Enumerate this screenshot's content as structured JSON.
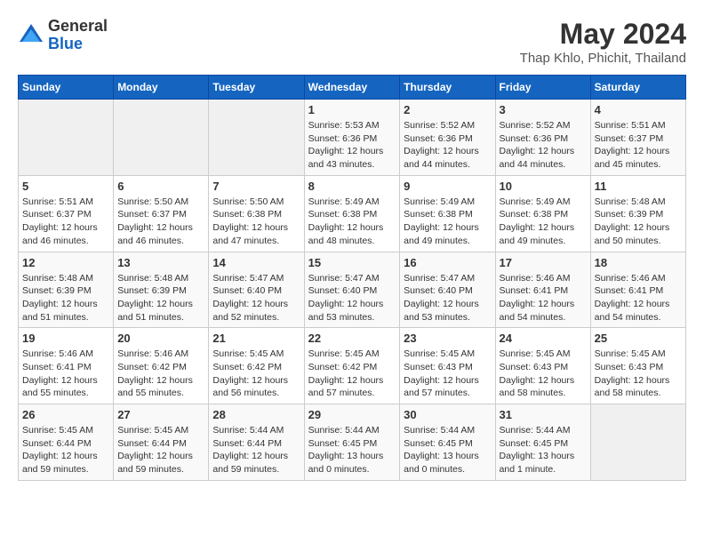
{
  "header": {
    "logo_line1": "General",
    "logo_line2": "Blue",
    "month": "May 2024",
    "location": "Thap Khlo, Phichit, Thailand"
  },
  "weekdays": [
    "Sunday",
    "Monday",
    "Tuesday",
    "Wednesday",
    "Thursday",
    "Friday",
    "Saturday"
  ],
  "weeks": [
    [
      {
        "day": "",
        "info": ""
      },
      {
        "day": "",
        "info": ""
      },
      {
        "day": "",
        "info": ""
      },
      {
        "day": "1",
        "info": "Sunrise: 5:53 AM\nSunset: 6:36 PM\nDaylight: 12 hours\nand 43 minutes."
      },
      {
        "day": "2",
        "info": "Sunrise: 5:52 AM\nSunset: 6:36 PM\nDaylight: 12 hours\nand 44 minutes."
      },
      {
        "day": "3",
        "info": "Sunrise: 5:52 AM\nSunset: 6:36 PM\nDaylight: 12 hours\nand 44 minutes."
      },
      {
        "day": "4",
        "info": "Sunrise: 5:51 AM\nSunset: 6:37 PM\nDaylight: 12 hours\nand 45 minutes."
      }
    ],
    [
      {
        "day": "5",
        "info": "Sunrise: 5:51 AM\nSunset: 6:37 PM\nDaylight: 12 hours\nand 46 minutes."
      },
      {
        "day": "6",
        "info": "Sunrise: 5:50 AM\nSunset: 6:37 PM\nDaylight: 12 hours\nand 46 minutes."
      },
      {
        "day": "7",
        "info": "Sunrise: 5:50 AM\nSunset: 6:38 PM\nDaylight: 12 hours\nand 47 minutes."
      },
      {
        "day": "8",
        "info": "Sunrise: 5:49 AM\nSunset: 6:38 PM\nDaylight: 12 hours\nand 48 minutes."
      },
      {
        "day": "9",
        "info": "Sunrise: 5:49 AM\nSunset: 6:38 PM\nDaylight: 12 hours\nand 49 minutes."
      },
      {
        "day": "10",
        "info": "Sunrise: 5:49 AM\nSunset: 6:38 PM\nDaylight: 12 hours\nand 49 minutes."
      },
      {
        "day": "11",
        "info": "Sunrise: 5:48 AM\nSunset: 6:39 PM\nDaylight: 12 hours\nand 50 minutes."
      }
    ],
    [
      {
        "day": "12",
        "info": "Sunrise: 5:48 AM\nSunset: 6:39 PM\nDaylight: 12 hours\nand 51 minutes."
      },
      {
        "day": "13",
        "info": "Sunrise: 5:48 AM\nSunset: 6:39 PM\nDaylight: 12 hours\nand 51 minutes."
      },
      {
        "day": "14",
        "info": "Sunrise: 5:47 AM\nSunset: 6:40 PM\nDaylight: 12 hours\nand 52 minutes."
      },
      {
        "day": "15",
        "info": "Sunrise: 5:47 AM\nSunset: 6:40 PM\nDaylight: 12 hours\nand 53 minutes."
      },
      {
        "day": "16",
        "info": "Sunrise: 5:47 AM\nSunset: 6:40 PM\nDaylight: 12 hours\nand 53 minutes."
      },
      {
        "day": "17",
        "info": "Sunrise: 5:46 AM\nSunset: 6:41 PM\nDaylight: 12 hours\nand 54 minutes."
      },
      {
        "day": "18",
        "info": "Sunrise: 5:46 AM\nSunset: 6:41 PM\nDaylight: 12 hours\nand 54 minutes."
      }
    ],
    [
      {
        "day": "19",
        "info": "Sunrise: 5:46 AM\nSunset: 6:41 PM\nDaylight: 12 hours\nand 55 minutes."
      },
      {
        "day": "20",
        "info": "Sunrise: 5:46 AM\nSunset: 6:42 PM\nDaylight: 12 hours\nand 55 minutes."
      },
      {
        "day": "21",
        "info": "Sunrise: 5:45 AM\nSunset: 6:42 PM\nDaylight: 12 hours\nand 56 minutes."
      },
      {
        "day": "22",
        "info": "Sunrise: 5:45 AM\nSunset: 6:42 PM\nDaylight: 12 hours\nand 57 minutes."
      },
      {
        "day": "23",
        "info": "Sunrise: 5:45 AM\nSunset: 6:43 PM\nDaylight: 12 hours\nand 57 minutes."
      },
      {
        "day": "24",
        "info": "Sunrise: 5:45 AM\nSunset: 6:43 PM\nDaylight: 12 hours\nand 58 minutes."
      },
      {
        "day": "25",
        "info": "Sunrise: 5:45 AM\nSunset: 6:43 PM\nDaylight: 12 hours\nand 58 minutes."
      }
    ],
    [
      {
        "day": "26",
        "info": "Sunrise: 5:45 AM\nSunset: 6:44 PM\nDaylight: 12 hours\nand 59 minutes."
      },
      {
        "day": "27",
        "info": "Sunrise: 5:45 AM\nSunset: 6:44 PM\nDaylight: 12 hours\nand 59 minutes."
      },
      {
        "day": "28",
        "info": "Sunrise: 5:44 AM\nSunset: 6:44 PM\nDaylight: 12 hours\nand 59 minutes."
      },
      {
        "day": "29",
        "info": "Sunrise: 5:44 AM\nSunset: 6:45 PM\nDaylight: 13 hours\nand 0 minutes."
      },
      {
        "day": "30",
        "info": "Sunrise: 5:44 AM\nSunset: 6:45 PM\nDaylight: 13 hours\nand 0 minutes."
      },
      {
        "day": "31",
        "info": "Sunrise: 5:44 AM\nSunset: 6:45 PM\nDaylight: 13 hours\nand 1 minute."
      },
      {
        "day": "",
        "info": ""
      }
    ]
  ]
}
